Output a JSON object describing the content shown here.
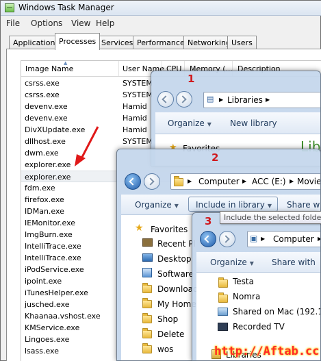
{
  "task_manager": {
    "title": "Windows Task Manager",
    "menu": [
      "File",
      "Options",
      "View",
      "Help"
    ],
    "tabs": [
      "Applications",
      "Processes",
      "Services",
      "Performance",
      "Networking",
      "Users"
    ],
    "active_tab": "Processes",
    "columns": [
      "Image Name",
      "User Name",
      "CPU",
      "Memory (...",
      "Description"
    ],
    "rows": [
      {
        "image": "csrss.exe",
        "user": "SYSTEM"
      },
      {
        "image": "csrss.exe",
        "user": "SYSTEM"
      },
      {
        "image": "devenv.exe",
        "user": "Hamid"
      },
      {
        "image": "devenv.exe",
        "user": "Hamid"
      },
      {
        "image": "DivXUpdate.exe",
        "user": "Hamid"
      },
      {
        "image": "dllhost.exe",
        "user": "SYSTEM"
      },
      {
        "image": "dwm.exe",
        "user": ""
      },
      {
        "image": "explorer.exe",
        "user": ""
      },
      {
        "image": "explorer.exe",
        "user": ""
      },
      {
        "image": "fdm.exe",
        "user": ""
      },
      {
        "image": "firefox.exe",
        "user": ""
      },
      {
        "image": "IDMan.exe",
        "user": ""
      },
      {
        "image": "IEMonitor.exe",
        "user": ""
      },
      {
        "image": "ImgBurn.exe",
        "user": ""
      },
      {
        "image": "IntelliTrace.exe",
        "user": ""
      },
      {
        "image": "IntelliTrace.exe",
        "user": ""
      },
      {
        "image": "iPodService.exe",
        "user": ""
      },
      {
        "image": "ipoint.exe",
        "user": ""
      },
      {
        "image": "iTunesHelper.exe",
        "user": ""
      },
      {
        "image": "jusched.exe",
        "user": ""
      },
      {
        "image": "Khaanaa.vshost.exe",
        "user": ""
      },
      {
        "image": "KMService.exe",
        "user": ""
      },
      {
        "image": "Lingoes.exe",
        "user": ""
      },
      {
        "image": "lsass.exe",
        "user": ""
      }
    ],
    "selected_row": 8
  },
  "window1": {
    "label": "1",
    "address": [
      "Libraries"
    ],
    "commands": {
      "organize": "Organize",
      "new_library": "New library"
    },
    "nav": {
      "favorites": "Favorites"
    },
    "heading_partial": "Libr"
  },
  "window2": {
    "label": "2",
    "address": [
      "Computer",
      "ACC (E:)",
      "Movies"
    ],
    "commands": {
      "organize": "Organize",
      "include": "Include in library",
      "share": "Share with"
    },
    "tooltip": "Include the selected folder",
    "nav": [
      "Favorites",
      "Recent Pl",
      "Desktop",
      "Software",
      "Download",
      "My Home",
      "Shop",
      "Delete",
      "wos"
    ]
  },
  "window3": {
    "label": "3",
    "address": [
      "Computer"
    ],
    "commands": {
      "organize": "Organize",
      "share": "Share with"
    },
    "items": [
      "Testa",
      "Nomra",
      "Shared on Mac (192.168.",
      "Recorded TV"
    ],
    "nav_bottom": "Libraries"
  },
  "watermark": "http://Aftab.cc",
  "colors": {
    "annotation": "#d0191d",
    "watermark": "#ff2a2a"
  }
}
